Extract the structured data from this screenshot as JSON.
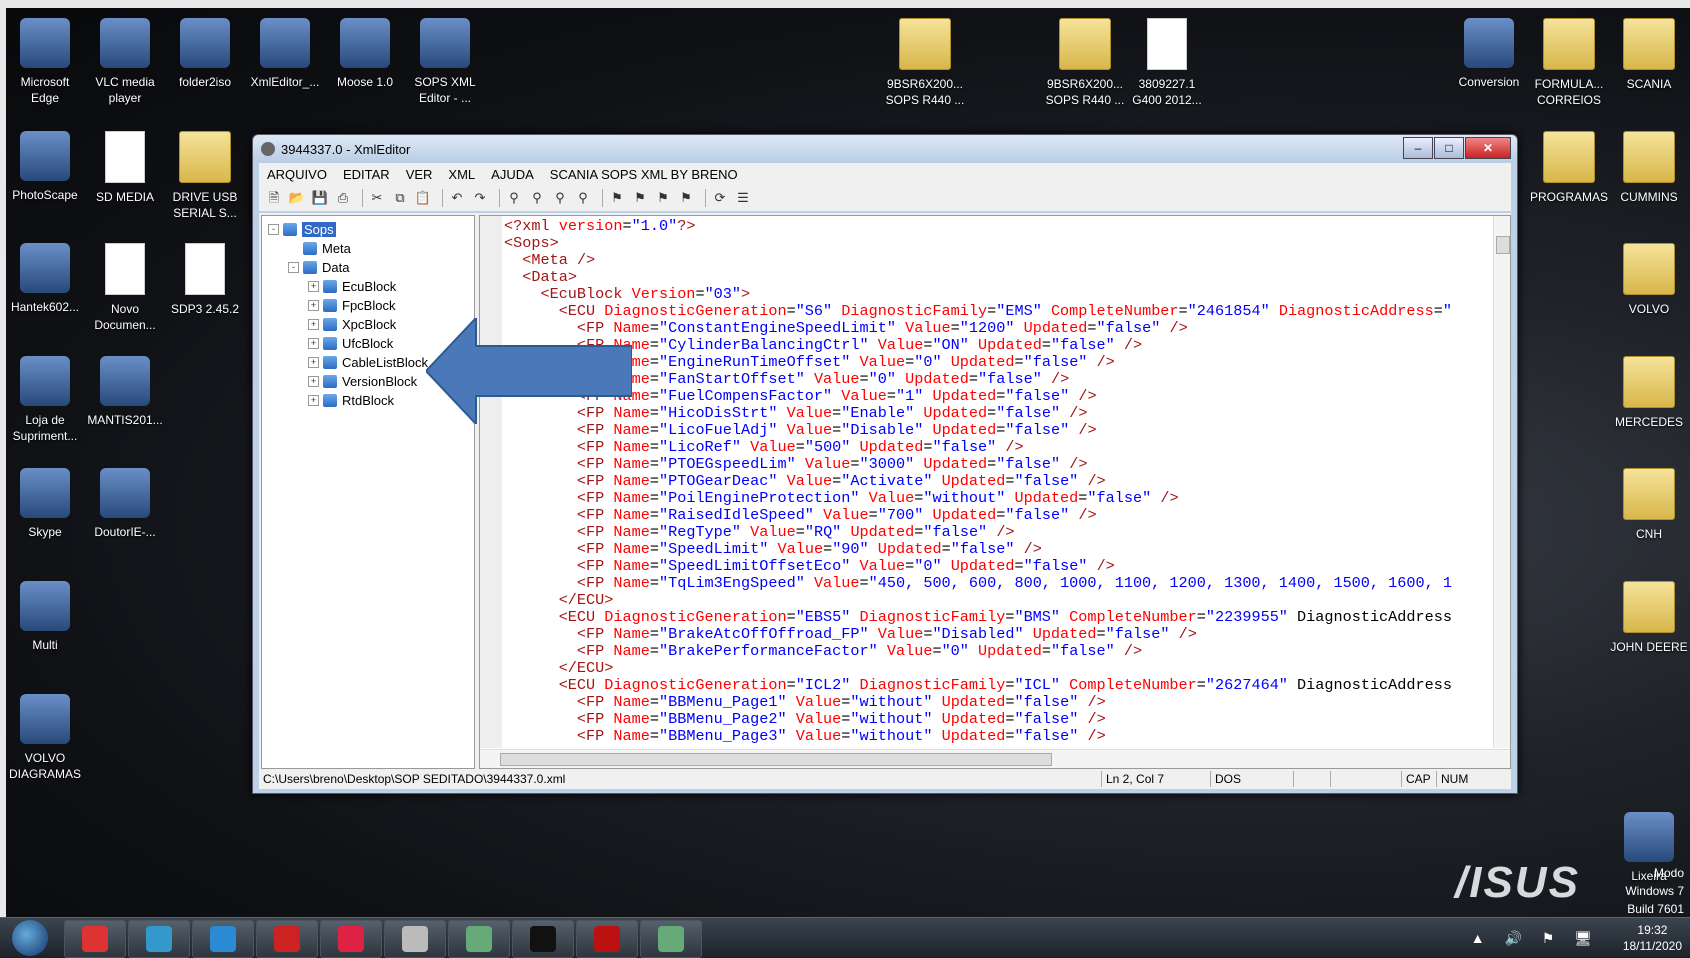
{
  "desktop": {
    "left_icons": [
      {
        "label": "Microsoft\nEdge",
        "name": "edge"
      },
      {
        "label": "VLC media\nplayer",
        "name": "vlc"
      },
      {
        "label": "folder2iso",
        "name": "folder2iso"
      },
      {
        "label": "XmlEditor_...",
        "name": "xmleditor"
      },
      {
        "label": "Moose 1.0",
        "name": "moose"
      },
      {
        "label": "SOPS XML\nEditor - ...",
        "name": "sops-xml-editor"
      },
      {
        "label": "PhotoScape",
        "name": "photoscape"
      },
      {
        "label": "SD MEDIA",
        "name": "sd-media"
      },
      {
        "label": "DRIVE USB\nSERIAL S...",
        "name": "drive-usb"
      },
      {
        "label": "Hantek602...",
        "name": "hantek"
      },
      {
        "label": "Novo\nDocumen...",
        "name": "novo-documento"
      },
      {
        "label": "SDP3 2.45.2",
        "name": "sdp3"
      },
      {
        "label": "Loja de\nSupriment...",
        "name": "loja"
      },
      {
        "label": "MANTIS201...",
        "name": "mantis"
      },
      {
        "label": "Skype",
        "name": "skype"
      },
      {
        "label": "DoutorIE-...",
        "name": "doutorie"
      },
      {
        "label": "Multi",
        "name": "multi"
      },
      {
        "label": "VOLVO\nDIAGRAMAS",
        "name": "volvo-diagramas"
      }
    ],
    "mid_icons": [
      {
        "label": "9BSR6X200...\nSOPS R440 ...",
        "name": "folder-9bsr-1"
      },
      {
        "label": "9BSR6X200...\nSOPS R440 ...",
        "name": "folder-9bsr-2"
      },
      {
        "label": "3809227.1\nG400 2012...",
        "name": "file-3809227"
      }
    ],
    "right_icons": [
      {
        "label": "Conversion",
        "name": "conversion"
      },
      {
        "label": "FORMULA...\nCORREIOS",
        "name": "formula-correios"
      },
      {
        "label": "SCANIA",
        "name": "scania"
      },
      {
        "label": "PROGRAMAS",
        "name": "programas"
      },
      {
        "label": "CUMMINS",
        "name": "cummins"
      },
      {
        "label": "VOLVO",
        "name": "volvo"
      },
      {
        "label": "MERCEDES",
        "name": "mercedes"
      },
      {
        "label": "CNH",
        "name": "cnh"
      },
      {
        "label": "JOHN DEERE",
        "name": "john-deere"
      },
      {
        "label": "Lixeira",
        "name": "lixeira"
      }
    ],
    "brand": "/ISUS",
    "watermark": [
      "Modo",
      "Windows 7",
      "Build 7601"
    ]
  },
  "window": {
    "title": "3944337.0 - XmlEditor",
    "menu": [
      "ARQUIVO",
      "EDITAR",
      "VER",
      "XML",
      "AJUDA",
      "SCANIA SOPS XML BY BRENO"
    ],
    "tree": [
      {
        "label": "Sops",
        "level": 0,
        "expander": "-",
        "selected": true
      },
      {
        "label": "Meta",
        "level": 1,
        "expander": "",
        "selected": false
      },
      {
        "label": "Data",
        "level": 1,
        "expander": "-",
        "selected": false
      },
      {
        "label": "EcuBlock",
        "level": 2,
        "expander": "+",
        "selected": false
      },
      {
        "label": "FpcBlock",
        "level": 2,
        "expander": "+",
        "selected": false
      },
      {
        "label": "XpcBlock",
        "level": 2,
        "expander": "+",
        "selected": false
      },
      {
        "label": "UfcBlock",
        "level": 2,
        "expander": "+",
        "selected": false
      },
      {
        "label": "CableListBlock",
        "level": 2,
        "expander": "+",
        "selected": false
      },
      {
        "label": "VersionBlock",
        "level": 2,
        "expander": "+",
        "selected": false
      },
      {
        "label": "RtdBlock",
        "level": 2,
        "expander": "+",
        "selected": false
      }
    ],
    "code_lines": [
      "<?xml version=\"1.0\"?>",
      "<Sops>",
      "  <Meta />",
      "  <Data>",
      "    <EcuBlock Version=\"03\">",
      "      <ECU DiagnosticGeneration=\"S6\" DiagnosticFamily=\"EMS\" CompleteNumber=\"2461854\" DiagnosticAddress=\"",
      "        <FP Name=\"ConstantEngineSpeedLimit\" Value=\"1200\" Updated=\"false\" />",
      "        <FP Name=\"CylinderBalancingCtrl\" Value=\"ON\" Updated=\"false\" />",
      "        <FP Name=\"EngineRunTimeOffset\" Value=\"0\" Updated=\"false\" />",
      "        <FP Name=\"FanStartOffset\" Value=\"0\" Updated=\"false\" />",
      "        <FP Name=\"FuelCompensFactor\" Value=\"1\" Updated=\"false\" />",
      "        <FP Name=\"HicoDisStrt\" Value=\"Enable\" Updated=\"false\" />",
      "        <FP Name=\"LicoFuelAdj\" Value=\"Disable\" Updated=\"false\" />",
      "        <FP Name=\"LicoRef\" Value=\"500\" Updated=\"false\" />",
      "        <FP Name=\"PTOEGspeedLim\" Value=\"3000\" Updated=\"false\" />",
      "        <FP Name=\"PTOGearDeac\" Value=\"Activate\" Updated=\"false\" />",
      "        <FP Name=\"PoilEngineProtection\" Value=\"without\" Updated=\"false\" />",
      "        <FP Name=\"RaisedIdleSpeed\" Value=\"700\" Updated=\"false\" />",
      "        <FP Name=\"RegType\" Value=\"RQ\" Updated=\"false\" />",
      "        <FP Name=\"SpeedLimit\" Value=\"90\" Updated=\"false\" />",
      "        <FP Name=\"SpeedLimitOffsetEco\" Value=\"0\" Updated=\"false\" />",
      "        <FP Name=\"TqLim3EngSpeed\" Value=\"450, 500, 600, 800, 1000, 1100, 1200, 1300, 1400, 1500, 1600, 1",
      "      </ECU>",
      "      <ECU DiagnosticGeneration=\"EBS5\" DiagnosticFamily=\"BMS\" CompleteNumber=\"2239955\" DiagnosticAddress",
      "        <FP Name=\"BrakeAtcOffOffroad_FP\" Value=\"Disabled\" Updated=\"false\" />",
      "        <FP Name=\"BrakePerformanceFactor\" Value=\"0\" Updated=\"false\" />",
      "      </ECU>",
      "      <ECU DiagnosticGeneration=\"ICL2\" DiagnosticFamily=\"ICL\" CompleteNumber=\"2627464\" DiagnosticAddress",
      "        <FP Name=\"BBMenu_Page1\" Value=\"without\" Updated=\"false\" />",
      "        <FP Name=\"BBMenu_Page2\" Value=\"without\" Updated=\"false\" />",
      "        <FP Name=\"BBMenu_Page3\" Value=\"without\" Updated=\"false\" />"
    ],
    "status": {
      "path": "C:\\Users\\breno\\Desktop\\SOP SEDITADO\\3944337.0.xml",
      "position": "Ln 2, Col 7",
      "encoding": "DOS",
      "caps": "CAP",
      "num": "NUM"
    }
  },
  "taskbar": {
    "time": "19:32",
    "date": "18/11/2020",
    "apps": [
      "chrome",
      "internet-explorer",
      "edge",
      "mcafee",
      "powerpoint",
      "sops-xml-editor",
      "xmleditor",
      "sdp3",
      "acrobat",
      "xmleditor-active"
    ]
  },
  "colors": {
    "tag": "#a31515",
    "attr": "#ff0000",
    "value": "#0000ff",
    "text": "#000000",
    "arrow": "#4a78b8"
  }
}
